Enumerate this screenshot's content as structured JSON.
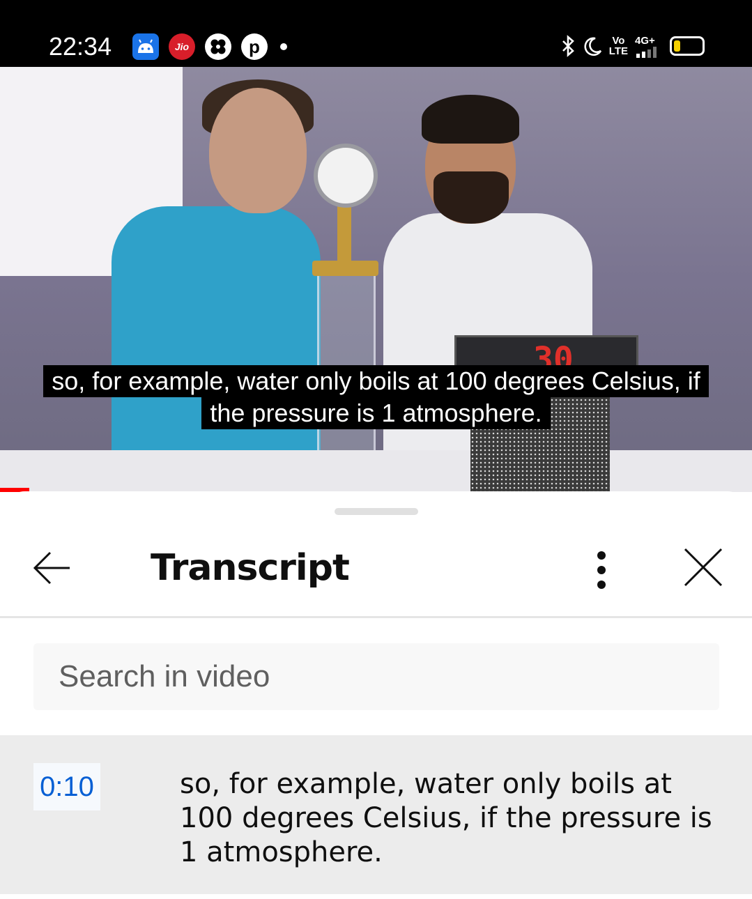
{
  "status_bar": {
    "time": "22:34",
    "left_icons": [
      "android-icon",
      "jio-icon",
      "clover-icon",
      "pinterest-icon",
      "dot"
    ],
    "jio_label": "Jio",
    "right_icons": [
      "bluetooth-icon",
      "moon-icon",
      "volte-icon",
      "signal-4g-icon",
      "battery-icon"
    ],
    "volte_top": "Vo",
    "volte_bottom": "LTE",
    "network": "4G+"
  },
  "video": {
    "caption_line1": "so, for example, water only boils at 100 degrees Celsius, if",
    "caption_line2": "the pressure is 1 atmosphere.",
    "display_digits": "30"
  },
  "transcript_panel": {
    "title": "Transcript",
    "search_placeholder": "Search in video",
    "segments": [
      {
        "timestamp": "0:10",
        "text": "so, for example, water only boils at 100 degrees Celsius, if the pressure is 1 atmosphere."
      }
    ]
  },
  "colors": {
    "timestamp_blue": "#065fd4",
    "progress_red": "#ff0000",
    "segment_bg": "#ececec"
  }
}
